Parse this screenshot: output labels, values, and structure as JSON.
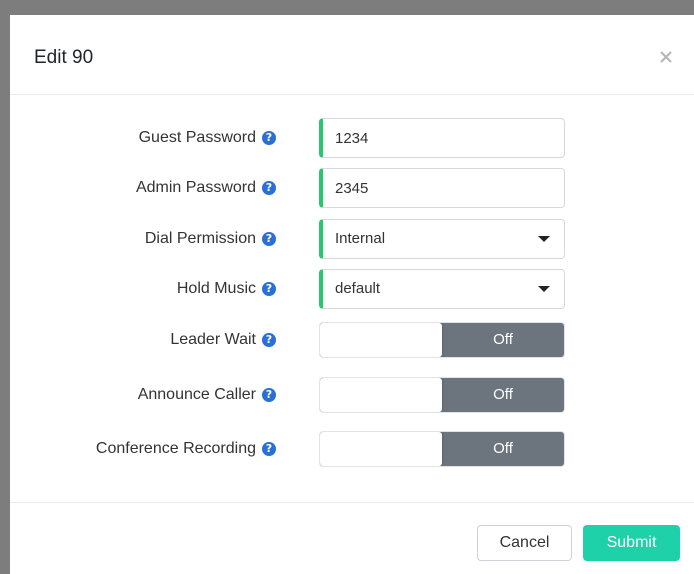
{
  "modal": {
    "title": "Edit 90",
    "close_icon": "close-icon"
  },
  "form": {
    "guest_password": {
      "label": "Guest Password",
      "value": "1234"
    },
    "admin_password": {
      "label": "Admin Password",
      "value": "2345"
    },
    "dial_permission": {
      "label": "Dial Permission",
      "value": "Internal"
    },
    "hold_music": {
      "label": "Hold Music",
      "value": "default"
    },
    "leader_wait": {
      "label": "Leader Wait",
      "state": "Off"
    },
    "announce_caller": {
      "label": "Announce Caller",
      "state": "Off"
    },
    "conference_recording": {
      "label": "Conference Recording",
      "state": "Off"
    },
    "help_glyph": "?"
  },
  "footer": {
    "cancel_label": "Cancel",
    "submit_label": "Submit"
  },
  "colors": {
    "accent_green": "#28c76f",
    "submit_teal": "#1fd1a8",
    "toggle_off": "#6c757d",
    "help_blue": "#2a6fd6"
  }
}
